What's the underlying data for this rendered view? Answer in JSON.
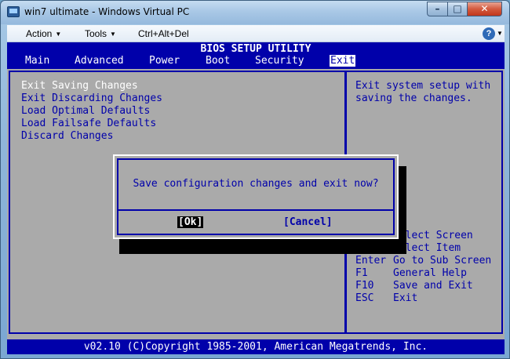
{
  "window": {
    "title": "win7 ultimate - Windows Virtual PC",
    "controls": {
      "minimize": "–",
      "maximize": "□",
      "close": "✕"
    }
  },
  "menubar": {
    "action": "Action",
    "tools": "Tools",
    "ctrl_alt_del": "Ctrl+Alt+Del",
    "help": "?"
  },
  "bios": {
    "title": "BIOS SETUP UTILITY",
    "tabs": [
      "Main",
      "Advanced",
      "Power",
      "Boot",
      "Security",
      "Exit"
    ],
    "active_tab": "Exit",
    "menu_items": [
      "Exit Saving Changes",
      "Exit Discarding Changes",
      "Load Optimal Defaults",
      "Load Failsafe Defaults",
      "Discard Changes"
    ],
    "selected_item": "Exit Saving Changes",
    "help_text": "Exit system setup with\nsaving the changes.",
    "keys": [
      {
        "key": "←",
        "desc": "Select Screen"
      },
      {
        "key": "↑↓",
        "desc": "Select Item"
      },
      {
        "key": "Enter",
        "desc": "Go to Sub Screen"
      },
      {
        "key": "F1",
        "desc": "General Help"
      },
      {
        "key": "F10",
        "desc": "Save and Exit"
      },
      {
        "key": "ESC",
        "desc": "Exit"
      }
    ],
    "footer": "v02.10 (C)Copyright 1985-2001, American Megatrends, Inc."
  },
  "dialog": {
    "question": "Save configuration changes and exit now?",
    "ok": "[Ok]",
    "cancel": "[Cancel]"
  },
  "colors": {
    "bios_blue": "#0000aa",
    "bios_gray": "#aaaaaa",
    "highlight": "#ffffff"
  }
}
